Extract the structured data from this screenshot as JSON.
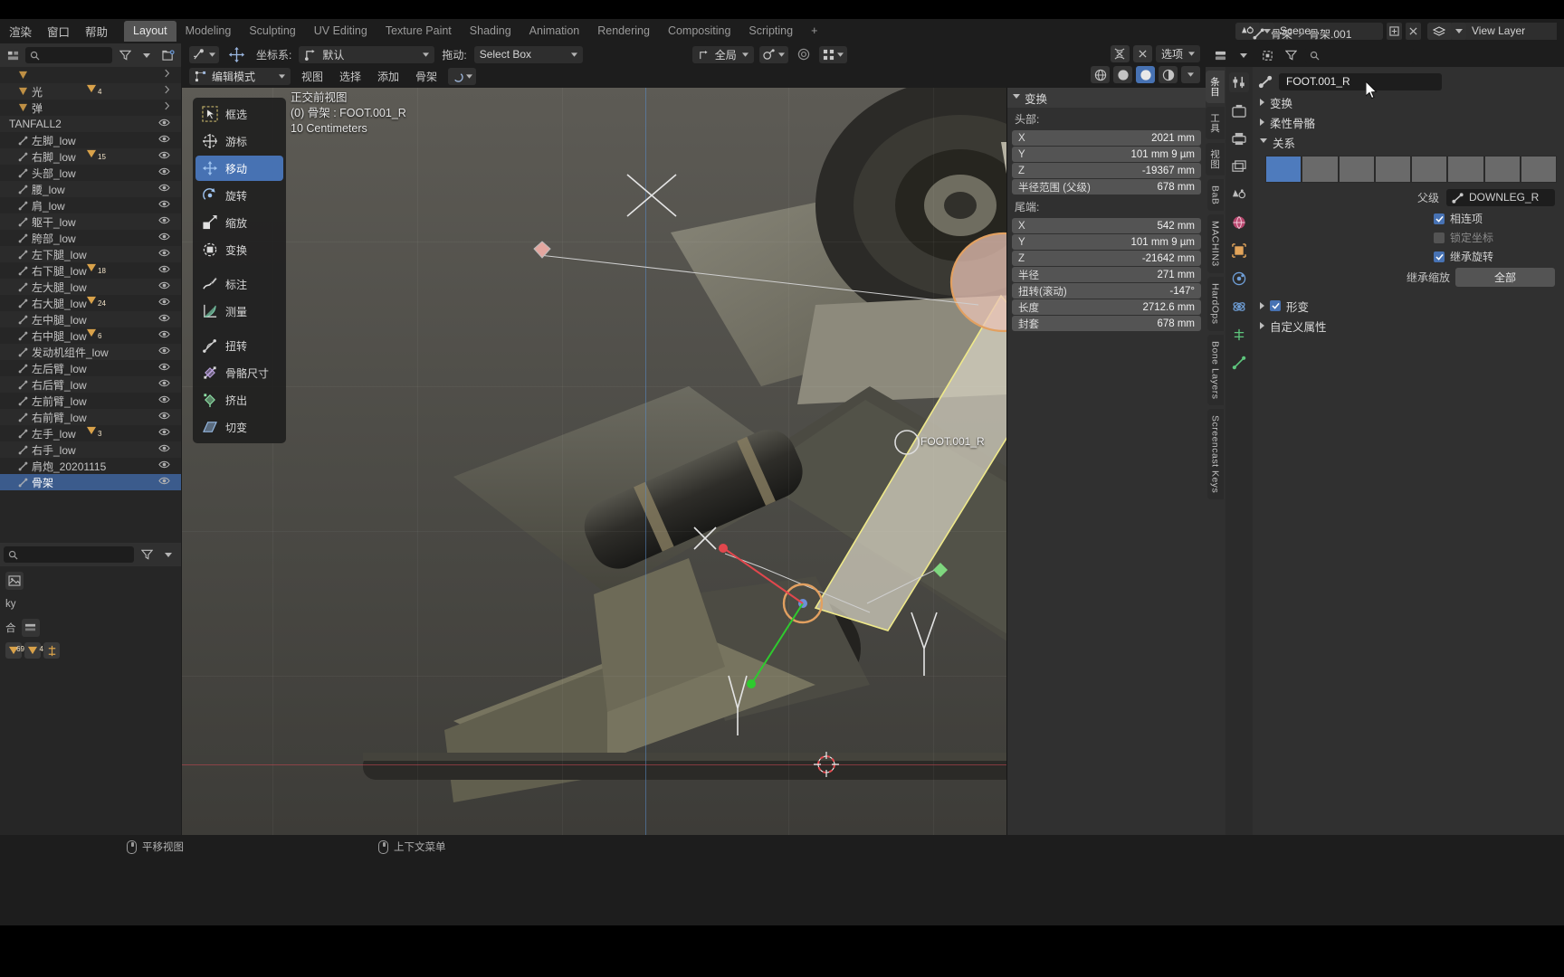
{
  "app": {
    "menus": [
      "渲染",
      "窗口",
      "帮助"
    ],
    "tabs": [
      {
        "label": "Layout",
        "active": true
      },
      {
        "label": "Modeling",
        "active": false
      },
      {
        "label": "Sculpting",
        "active": false
      },
      {
        "label": "UV Editing",
        "active": false
      },
      {
        "label": "Texture Paint",
        "active": false
      },
      {
        "label": "Shading",
        "active": false
      },
      {
        "label": "Animation",
        "active": false
      },
      {
        "label": "Rendering",
        "active": false
      },
      {
        "label": "Compositing",
        "active": false
      },
      {
        "label": "Scripting",
        "active": false
      },
      {
        "label": "+",
        "active": false
      }
    ],
    "scene_name": "Scene",
    "view_layer_name": "View Layer"
  },
  "outliner": {
    "search_placeholder": "",
    "rows": [
      {
        "label": "",
        "indent": 1,
        "icon": "mesh-triangle",
        "badge": "",
        "type": "collapsed"
      },
      {
        "label": "光",
        "indent": 1,
        "icon": "light",
        "badge": "4",
        "type": "collapsed"
      },
      {
        "label": "弹",
        "indent": 1,
        "icon": "mesh-triangle",
        "badge": "",
        "type": "collapsed"
      },
      {
        "label": "TANFALL2",
        "indent": 0,
        "icon": "none",
        "badge": "",
        "type": "item"
      },
      {
        "label": "左脚_low",
        "indent": 1,
        "icon": "bone",
        "badge": "",
        "type": "item"
      },
      {
        "label": "右脚_low",
        "indent": 1,
        "icon": "bone",
        "badge": "15",
        "type": "item"
      },
      {
        "label": "头部_low",
        "indent": 1,
        "icon": "bone",
        "badge": "",
        "type": "item"
      },
      {
        "label": "腰_low",
        "indent": 1,
        "icon": "bone",
        "badge": "",
        "type": "item"
      },
      {
        "label": "肩_low",
        "indent": 1,
        "icon": "bone",
        "badge": "",
        "type": "item"
      },
      {
        "label": "躯干_low",
        "indent": 1,
        "icon": "bone",
        "badge": "",
        "type": "item"
      },
      {
        "label": "胯部_low",
        "indent": 1,
        "icon": "bone",
        "badge": "",
        "type": "item"
      },
      {
        "label": "左下腿_low",
        "indent": 1,
        "icon": "bone",
        "badge": "",
        "type": "item"
      },
      {
        "label": "右下腿_low",
        "indent": 1,
        "icon": "bone",
        "badge": "18",
        "type": "item"
      },
      {
        "label": "左大腿_low",
        "indent": 1,
        "icon": "bone",
        "badge": "",
        "type": "item"
      },
      {
        "label": "右大腿_low",
        "indent": 1,
        "icon": "bone",
        "badge": "24",
        "type": "item"
      },
      {
        "label": "左中腿_low",
        "indent": 1,
        "icon": "bone",
        "badge": "",
        "type": "item"
      },
      {
        "label": "右中腿_low",
        "indent": 1,
        "icon": "bone",
        "badge": "6",
        "type": "item"
      },
      {
        "label": "发动机组件_low",
        "indent": 1,
        "icon": "bone",
        "badge": "",
        "type": "item"
      },
      {
        "label": "左后臂_low",
        "indent": 1,
        "icon": "bone",
        "badge": "",
        "type": "item"
      },
      {
        "label": "右后臂_low",
        "indent": 1,
        "icon": "bone",
        "badge": "",
        "type": "item"
      },
      {
        "label": "左前臂_low",
        "indent": 1,
        "icon": "bone",
        "badge": "",
        "type": "item"
      },
      {
        "label": "右前臂_low",
        "indent": 1,
        "icon": "bone",
        "badge": "",
        "type": "item"
      },
      {
        "label": "左手_low",
        "indent": 1,
        "icon": "bone",
        "badge": "3",
        "type": "item"
      },
      {
        "label": "右手_low",
        "indent": 1,
        "icon": "bone",
        "badge": "",
        "type": "item"
      },
      {
        "label": "肩炮_20201115",
        "indent": 1,
        "icon": "bone",
        "badge": "",
        "type": "item"
      },
      {
        "label": "骨架",
        "indent": 1,
        "icon": "armature",
        "badge": "",
        "type": "selected"
      }
    ]
  },
  "viewport_header": {
    "transform_pivot_label": "",
    "coord_label": "坐标系:",
    "orientation_value": "默认",
    "drag_label": "拖动:",
    "drag_value": "Select Box",
    "global_value": "全局",
    "mode_value": "编辑模式",
    "menus": [
      "视图",
      "选择",
      "添加",
      "骨架"
    ],
    "options_label": "选项"
  },
  "viewport_overlay": {
    "view_name": "正交前视图",
    "object_line": "(0) 骨架 : FOOT.001_R",
    "grid_scale": "10 Centimeters",
    "bone_label": "FOOT.001_R"
  },
  "toolbar": {
    "tools": [
      {
        "label": "框选",
        "icon": "select-box-icon",
        "active": false
      },
      {
        "label": "游标",
        "icon": "cursor-icon",
        "active": false
      },
      {
        "label": "移动",
        "icon": "move-icon",
        "active": true
      },
      {
        "label": "旋转",
        "icon": "rotate-icon",
        "active": false
      },
      {
        "label": "缩放",
        "icon": "scale-icon",
        "active": false
      },
      {
        "label": "变换",
        "icon": "transform-icon",
        "active": false
      },
      {
        "label": "标注",
        "icon": "annotate-icon",
        "active": false
      },
      {
        "label": "测量",
        "icon": "measure-icon",
        "active": false
      },
      {
        "label": "扭转",
        "icon": "roll-icon",
        "active": false
      },
      {
        "label": "骨骼尺寸",
        "icon": "bone-size-icon",
        "active": false
      },
      {
        "label": "挤出",
        "icon": "extrude-icon",
        "active": false
      },
      {
        "label": "切变",
        "icon": "shear-icon",
        "active": false
      }
    ]
  },
  "npanel": {
    "tabs": [
      {
        "label": "条目",
        "sel": true
      },
      {
        "label": "工具",
        "sel": false
      },
      {
        "label": "视图",
        "sel": false
      },
      {
        "label": "BaB",
        "sel": false
      },
      {
        "label": "MACHIN3",
        "sel": false
      },
      {
        "label": "HardOps",
        "sel": false
      },
      {
        "label": "Bone Layers",
        "sel": false
      },
      {
        "label": "Screencast Keys",
        "sel": false
      }
    ],
    "section_title": "变换",
    "head_label": "头部:",
    "head_fields": [
      {
        "key": "X",
        "value": "2021 mm"
      },
      {
        "key": "Y",
        "value": "101 mm 9 µm"
      },
      {
        "key": "Z",
        "value": "-19367 mm"
      },
      {
        "key": "半径范围 (父级)",
        "value": "678 mm"
      }
    ],
    "tail_label": "尾端:",
    "tail_fields": [
      {
        "key": "X",
        "value": "542 mm"
      },
      {
        "key": "Y",
        "value": "101 mm 9 µm"
      },
      {
        "key": "Z",
        "value": "-21642 mm"
      },
      {
        "key": "半径",
        "value": "271 mm"
      },
      {
        "key": "扭转(滚动)",
        "value": "-147°"
      },
      {
        "key": "长度",
        "value": "2712.6 mm"
      },
      {
        "key": "封套",
        "value": "678 mm"
      }
    ]
  },
  "properties": {
    "breadcrumb_name": "骨架",
    "breadcrumb_bone": "骨架.001",
    "bone_name": "FOOT.001_R",
    "sections": [
      {
        "label": "变换",
        "open": false
      },
      {
        "label": "柔性骨骼",
        "open": false
      },
      {
        "label": "关系",
        "open": true
      },
      {
        "label": "形变",
        "open": false,
        "checkbox": true
      },
      {
        "label": "自定义属性",
        "open": false
      }
    ],
    "relations": {
      "parent_label": "父级",
      "parent_value": "DOWNLEG_R",
      "connected_label": "相连项",
      "connected_checked": true,
      "local_label": "锁定坐标",
      "local_checked": false,
      "inherit_rot_label": "继承旋转",
      "inherit_rot_checked": true,
      "inherit_scale_label": "继承缩放",
      "inherit_scale_value": "全部"
    }
  },
  "statusbar": {
    "items": [
      {
        "icon": "mouse-middle-icon",
        "label": "平移视图"
      },
      {
        "icon": "mouse-right-icon",
        "label": "上下文菜单"
      }
    ]
  },
  "colors": {
    "accent_blue": "#4772b3",
    "panel_bg": "#303030",
    "editor_bg": "#262626",
    "header_bg": "#1d1d1d",
    "bone_orange": "#d9a24a"
  }
}
